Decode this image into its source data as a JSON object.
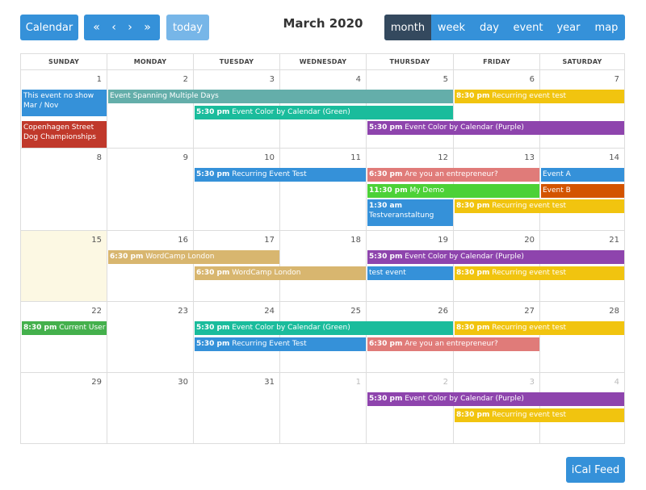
{
  "toolbar": {
    "calendar_label": "Calendar",
    "nav": [
      {
        "name": "prev-year-button",
        "glyph": "«"
      },
      {
        "name": "prev-month-button",
        "glyph": "‹"
      },
      {
        "name": "next-month-button",
        "glyph": "›"
      },
      {
        "name": "next-year-button",
        "glyph": "»"
      }
    ],
    "today_label": "today",
    "title": "March 2020",
    "views": [
      {
        "label": "month",
        "active": true
      },
      {
        "label": "week",
        "active": false
      },
      {
        "label": "day",
        "active": false
      },
      {
        "label": "event",
        "active": false
      },
      {
        "label": "year",
        "active": false
      },
      {
        "label": "map",
        "active": false
      }
    ]
  },
  "colors": {
    "accent": "#3591d9",
    "today_bg": "#fcf8e3",
    "blue": "#3591d9",
    "teal": "#64aeaa",
    "green_cal": "#1abc9c",
    "purple": "#8e44ad",
    "yellow": "#f1c40f",
    "red": "#c0392b",
    "pink": "#e07b79",
    "lime": "#4cd137",
    "orange": "#d35400",
    "tan": "#d8b66f",
    "green": "#44b04c"
  },
  "days_of_week": [
    "SUNDAY",
    "MONDAY",
    "TUESDAY",
    "WEDNESDAY",
    "THURSDAY",
    "FRIDAY",
    "SATURDAY"
  ],
  "weeks": [
    {
      "days": [
        {
          "n": "1"
        },
        {
          "n": "2"
        },
        {
          "n": "3"
        },
        {
          "n": "4"
        },
        {
          "n": "5"
        },
        {
          "n": "6"
        },
        {
          "n": "7"
        }
      ]
    },
    {
      "days": [
        {
          "n": "8"
        },
        {
          "n": "9"
        },
        {
          "n": "10"
        },
        {
          "n": "11"
        },
        {
          "n": "12"
        },
        {
          "n": "13"
        },
        {
          "n": "14"
        }
      ]
    },
    {
      "days": [
        {
          "n": "15",
          "today": true
        },
        {
          "n": "16"
        },
        {
          "n": "17"
        },
        {
          "n": "18"
        },
        {
          "n": "19"
        },
        {
          "n": "20"
        },
        {
          "n": "21"
        }
      ]
    },
    {
      "days": [
        {
          "n": "22"
        },
        {
          "n": "23"
        },
        {
          "n": "24"
        },
        {
          "n": "25"
        },
        {
          "n": "26"
        },
        {
          "n": "27"
        },
        {
          "n": "28"
        }
      ]
    },
    {
      "days": [
        {
          "n": "29"
        },
        {
          "n": "30"
        },
        {
          "n": "31"
        },
        {
          "n": "1",
          "other": true
        },
        {
          "n": "2",
          "other": true
        },
        {
          "n": "3",
          "other": true
        },
        {
          "n": "4",
          "other": true
        }
      ]
    }
  ],
  "events": [
    {
      "week": 0,
      "start": 0,
      "span": 1,
      "slot": 0,
      "lines": 2,
      "time": "",
      "title": "This event no show Mar / Nov",
      "color": "blue"
    },
    {
      "week": 0,
      "start": 0,
      "span": 1,
      "slot": 2,
      "lines": 2,
      "time": "",
      "title": "Copenhagen Street Dog Championships",
      "color": "red"
    },
    {
      "week": 0,
      "start": 1,
      "span": 4,
      "slot": 0,
      "lines": 1,
      "time": "",
      "title": "Event Spanning Multiple Days",
      "color": "teal"
    },
    {
      "week": 0,
      "start": 5,
      "span": 2,
      "slot": 0,
      "lines": 1,
      "time": "8:30 pm",
      "title": "Recurring event test",
      "color": "yellow"
    },
    {
      "week": 0,
      "start": 2,
      "span": 3,
      "slot": 1,
      "lines": 1,
      "time": "5:30 pm",
      "title": "Event Color by Calendar (Green)",
      "color": "green_cal"
    },
    {
      "week": 0,
      "start": 4,
      "span": 3,
      "slot": 2,
      "lines": 1,
      "time": "5:30 pm",
      "title": "Event Color by Calendar (Purple)",
      "color": "purple"
    },
    {
      "week": 1,
      "start": 2,
      "span": 2,
      "slot": 0,
      "lines": 1,
      "time": "5:30 pm",
      "title": "Recurring Event Test",
      "color": "blue"
    },
    {
      "week": 1,
      "start": 4,
      "span": 2,
      "slot": 0,
      "lines": 1,
      "time": "6:30 pm",
      "title": "Are you an entrepreneur?",
      "color": "pink"
    },
    {
      "week": 1,
      "start": 6,
      "span": 1,
      "slot": 0,
      "lines": 1,
      "time": "",
      "title": "Event A",
      "color": "blue"
    },
    {
      "week": 1,
      "start": 4,
      "span": 2,
      "slot": 1,
      "lines": 1,
      "time": "11:30 pm",
      "title": "My Demo",
      "color": "lime"
    },
    {
      "week": 1,
      "start": 6,
      "span": 1,
      "slot": 1,
      "lines": 1,
      "time": "",
      "title": "Event B",
      "color": "orange"
    },
    {
      "week": 1,
      "start": 4,
      "span": 1,
      "slot": 2,
      "lines": 2,
      "time": "1:30 am",
      "title": "Testveranstaltung",
      "color": "blue"
    },
    {
      "week": 1,
      "start": 5,
      "span": 2,
      "slot": 2,
      "lines": 1,
      "time": "8:30 pm",
      "title": "Recurring event test",
      "color": "yellow"
    },
    {
      "week": 2,
      "start": 1,
      "span": 2,
      "slot": 0,
      "lines": 1,
      "time": "6:30 pm",
      "title": "WordCamp London",
      "color": "tan"
    },
    {
      "week": 2,
      "start": 4,
      "span": 3,
      "slot": 0,
      "lines": 1,
      "time": "5:30 pm",
      "title": "Event Color by Calendar (Purple)",
      "color": "purple"
    },
    {
      "week": 2,
      "start": 2,
      "span": 2,
      "slot": 1,
      "lines": 1,
      "time": "6:30 pm",
      "title": "WordCamp London",
      "color": "tan"
    },
    {
      "week": 2,
      "start": 4,
      "span": 1,
      "slot": 1,
      "lines": 1,
      "time": "",
      "title": "test event",
      "color": "blue"
    },
    {
      "week": 2,
      "start": 5,
      "span": 2,
      "slot": 1,
      "lines": 1,
      "time": "8:30 pm",
      "title": "Recurring event test",
      "color": "yellow"
    },
    {
      "week": 3,
      "start": 0,
      "span": 1,
      "slot": 0,
      "lines": 1,
      "time": "8:30 pm",
      "title": "Current User",
      "color": "green"
    },
    {
      "week": 3,
      "start": 2,
      "span": 3,
      "slot": 0,
      "lines": 1,
      "time": "5:30 pm",
      "title": "Event Color by Calendar (Green)",
      "color": "green_cal"
    },
    {
      "week": 3,
      "start": 5,
      "span": 2,
      "slot": 0,
      "lines": 1,
      "time": "8:30 pm",
      "title": "Recurring event test",
      "color": "yellow"
    },
    {
      "week": 3,
      "start": 2,
      "span": 2,
      "slot": 1,
      "lines": 1,
      "time": "5:30 pm",
      "title": "Recurring Event Test",
      "color": "blue"
    },
    {
      "week": 3,
      "start": 4,
      "span": 2,
      "slot": 1,
      "lines": 1,
      "time": "6:30 pm",
      "title": "Are you an entrepreneur?",
      "color": "pink"
    },
    {
      "week": 4,
      "start": 4,
      "span": 3,
      "slot": 0,
      "lines": 1,
      "time": "5:30 pm",
      "title": "Event Color by Calendar (Purple)",
      "color": "purple"
    },
    {
      "week": 4,
      "start": 5,
      "span": 2,
      "slot": 1,
      "lines": 1,
      "time": "8:30 pm",
      "title": "Recurring event test",
      "color": "yellow"
    }
  ],
  "footer": {
    "ical_label": "iCal Feed"
  }
}
